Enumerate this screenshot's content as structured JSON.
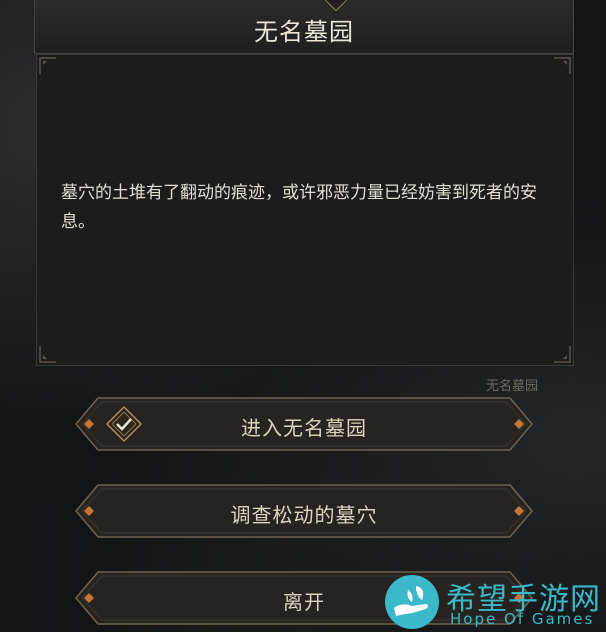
{
  "dialog": {
    "title": "无名墓园",
    "description": "墓穴的土堆有了翻动的痕迹，或许邪恶力量已经妨害到死者的安息。",
    "location_tag": "无名墓园"
  },
  "options": [
    {
      "label": "进入无名墓园",
      "selected": true
    },
    {
      "label": "调查松动的墓穴",
      "selected": false
    },
    {
      "label": "离开",
      "selected": false
    }
  ],
  "watermark": {
    "cn": "希望手游网",
    "en": "Hope Of Games"
  },
  "colors": {
    "accent": "#c8753a",
    "frame": "#8a7a5c",
    "watermark": "#3bb8c9"
  }
}
